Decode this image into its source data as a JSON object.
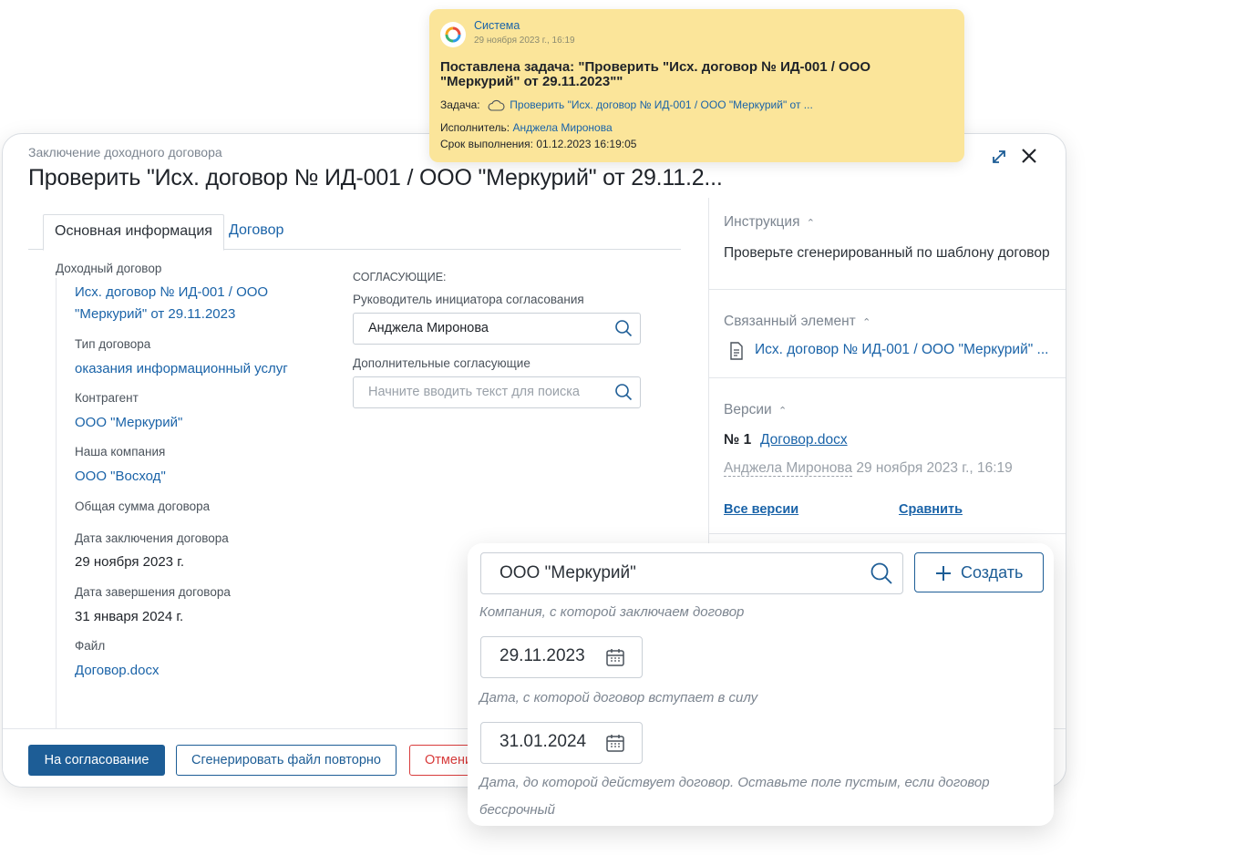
{
  "notification": {
    "sender": "Система",
    "timestamp": "29 ноября 2023 г., 16:19",
    "headline": "Поставлена задача: \"Проверить \"Исх. договор № ИД-001 / ООО \"Меркурий\" от 29.11.2023\"\"",
    "task_label": "Задача:",
    "task_link": "Проверить \"Исх. договор № ИД-001 / ООО \"Меркурий\" от ...",
    "assignee_label": "Исполнитель:",
    "assignee": "Анджела Миронова",
    "deadline_label": "Срок выполнения:",
    "deadline": "01.12.2023 16:19:05"
  },
  "modal": {
    "breadcrumb": "Заключение доходного договора",
    "title": "Проверить \"Исх. договор № ИД-001 / ООО \"Меркурий\" от 29.11.2...",
    "tabs": [
      {
        "label": "Основная информация",
        "active": true
      },
      {
        "label": "Договор",
        "active": false
      }
    ],
    "fields": {
      "income_contract_label": "Доходный договор",
      "income_contract_line1": "Исх. договор № ИД-001 / ООО",
      "income_contract_line2": "\"Меркурий\" от 29.11.2023",
      "contract_type_label": "Тип договора",
      "contract_type": "оказания информационный услуг",
      "counterparty_label": "Контрагент",
      "counterparty": "ООО \"Меркурий\"",
      "our_company_label": "Наша компания",
      "our_company": "ООО \"Восход\"",
      "total_label": "Общая сумма договора",
      "start_date_label": "Дата заключения договора",
      "start_date": "29 ноября 2023 г.",
      "end_date_label": "Дата завершения договора",
      "end_date": "31 января 2024 г.",
      "file_label": "Файл",
      "file": "Договор.docx"
    },
    "approvers": {
      "section_title": "СОГЛАСУЮЩИЕ:",
      "head_label": "Руководитель инициатора согласования",
      "head_value": "Анджела Миронова",
      "extra_label": "Дополнительные согласующие",
      "extra_placeholder": "Начните вводить текст для поиска"
    },
    "right_panel": {
      "instruction_title": "Инструкция",
      "instruction_text": "Проверьте сгенерированный по шаблону договор",
      "related_title": "Связанный элемент",
      "related_link": "Исх. договор № ИД-001 / ООО \"Меркурий\" ...",
      "versions_title": "Версии",
      "version_number": "№ 1",
      "version_file": "Договор.docx",
      "version_author": "Анджела Миронова",
      "version_date": "29 ноября 2023 г., 16:19",
      "all_versions": "Все версии",
      "compare": "Сравнить"
    },
    "footer": {
      "submit": "На согласование",
      "regenerate": "Сгенерировать файл повторно",
      "cancel": "Отмени"
    }
  },
  "card": {
    "company_value": "ООО \"Меркурий\"",
    "create_button": "Создать",
    "company_hint": "Компания, с которой заключаем договор",
    "start_date": "29.11.2023",
    "start_hint": "Дата, с которой договор вступает в силу",
    "end_date": "31.01.2024",
    "end_hint_line1": "Дата, до которой действует договор. Оставьте поле пустым, если договор",
    "end_hint_line2": "бессрочный"
  },
  "colors": {
    "link": "#1a63a8",
    "primary": "#1d5d96",
    "danger": "#d83b3b",
    "toast_bg": "#fbe59a"
  }
}
